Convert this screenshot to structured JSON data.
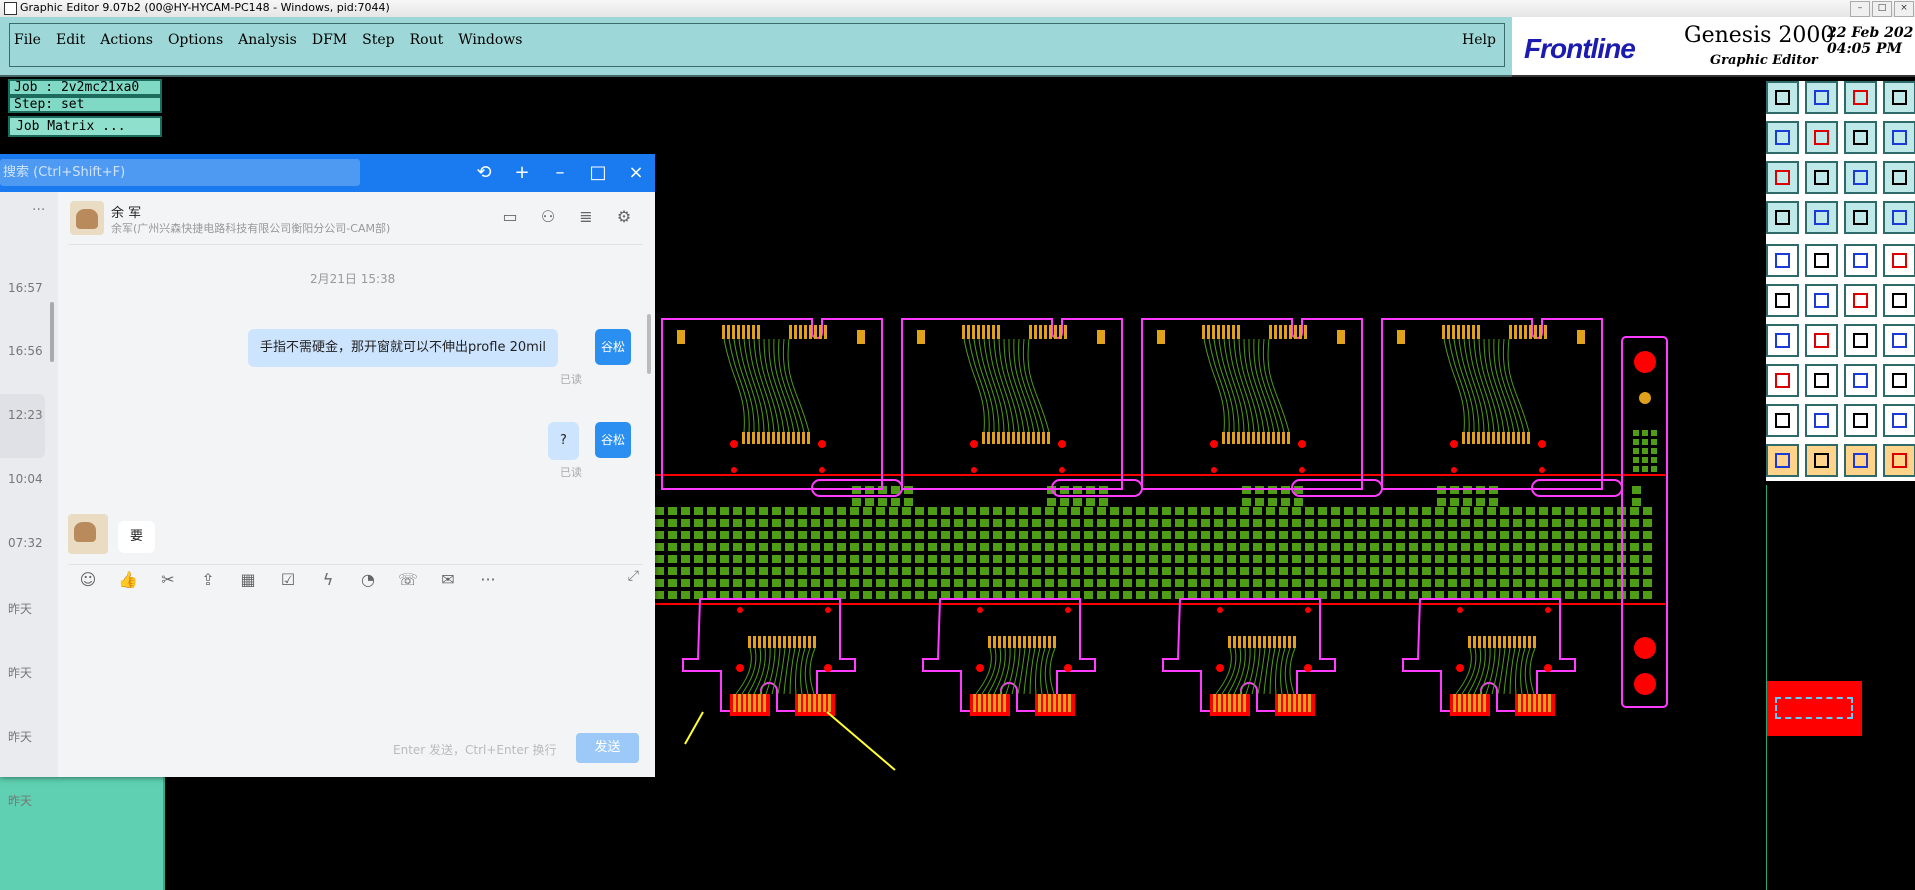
{
  "window": {
    "title": "Graphic Editor 9.07b2 (00@HY-HYCAM-PC148 - Windows, pid:7044)"
  },
  "menu": {
    "items": [
      "File",
      "Edit",
      "Actions",
      "Options",
      "Analysis",
      "DFM",
      "Step",
      "Rout",
      "Windows"
    ],
    "help": "Help"
  },
  "brand": {
    "logo": "Frontline",
    "product": "Genesis 2000",
    "subtitle": "Graphic Editor",
    "date": "22 Feb 202",
    "time": "04:05 PM"
  },
  "job": {
    "job": "Job : 2v2mc21xa0",
    "step": "Step: set",
    "matrix": "Job Matrix ..."
  },
  "chat": {
    "search_placeholder": "搜索 (Ctrl+Shift+F)",
    "contact_name": "余 军",
    "contact_org": "余军(广州兴森快捷电路科技有限公司衡阳分公司-CAM部)",
    "date_separator": "2月21日 15:38",
    "messages": [
      {
        "text": "手指不需硬金，那开窗就可以不伸出profle 20mil",
        "sender": "谷松",
        "status": "已读"
      },
      {
        "text": "?",
        "sender": "谷松",
        "status": "已读"
      },
      {
        "text": "要",
        "sender": ""
      }
    ],
    "sidebar_times": [
      "16:57",
      "16:56",
      "12:23",
      "10:04",
      "07:32",
      "昨天",
      "昨天",
      "昨天",
      "昨天"
    ],
    "input_hint": "Enter 发送，Ctrl+Enter 换行",
    "send_label": "发送"
  },
  "colors": {
    "menubar_bg": "#9ed7d7",
    "chat_blue": "#1a7bf0",
    "pcb_outline": "#ff3cff",
    "pcb_pad": "#4f9c17",
    "pcb_gold": "#e0a21b",
    "pcb_red": "#ff0000"
  }
}
